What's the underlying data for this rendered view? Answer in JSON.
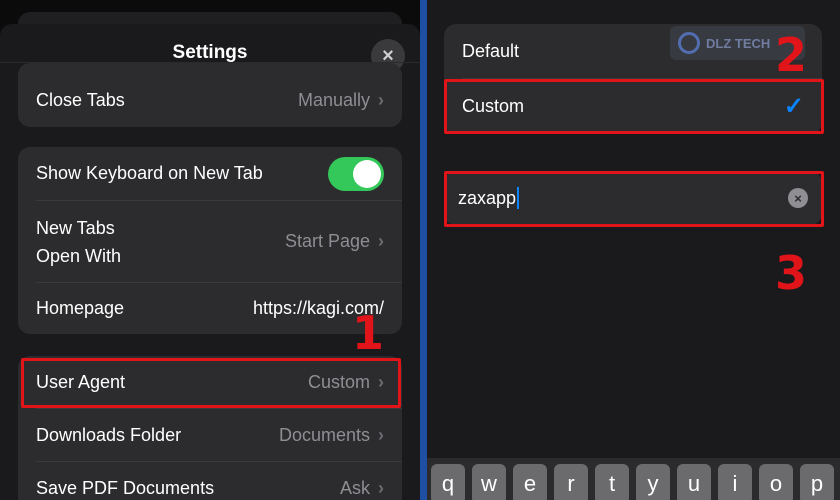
{
  "settings": {
    "title": "Settings",
    "close_icon": "×",
    "rows": {
      "close_tabs": {
        "label": "Close Tabs",
        "value": "Manually"
      },
      "show_keyboard": {
        "label": "Show Keyboard on New Tab",
        "toggle_on": true
      },
      "new_tabs": {
        "label_line1": "New Tabs",
        "label_line2": "Open With",
        "value": "Start Page"
      },
      "homepage": {
        "label": "Homepage",
        "value": "https://kagi.com/"
      },
      "user_agent": {
        "label": "User Agent",
        "value": "Custom"
      },
      "downloads": {
        "label": "Downloads Folder",
        "value": "Documents"
      },
      "save_pdf": {
        "label": "Save PDF Documents",
        "value": "Ask"
      }
    },
    "chevron": "›"
  },
  "user_agent_panel": {
    "options": [
      {
        "label": "Default",
        "selected": false
      },
      {
        "label": "Custom",
        "selected": true
      }
    ],
    "check_icon": "✓",
    "custom_value": "zaxapp",
    "clear_icon": "×",
    "watermark_text": "DLZ TECH"
  },
  "keyboard": {
    "keys": [
      "q",
      "w",
      "e",
      "r",
      "t",
      "y",
      "u",
      "i",
      "o",
      "p"
    ]
  },
  "annotations": {
    "step1": "1",
    "step2": "2",
    "step3": "3",
    "color": "#e1141a"
  },
  "colors": {
    "toggle_on": "#34c759",
    "checkmark": "#0a84ff",
    "divider": "#1f4fa3"
  }
}
